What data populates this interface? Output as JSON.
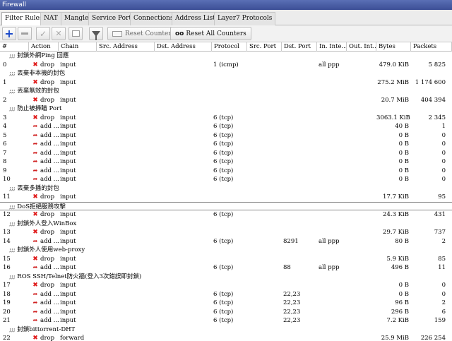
{
  "window": {
    "title": "Firewall"
  },
  "tabs": [
    {
      "label": "Filter Rules",
      "active": true
    },
    {
      "label": "NAT",
      "active": false
    },
    {
      "label": "Mangle",
      "active": false
    },
    {
      "label": "Service Ports",
      "active": false
    },
    {
      "label": "Connections",
      "active": false
    },
    {
      "label": "Address Lists",
      "active": false
    },
    {
      "label": "Layer7 Protocols",
      "active": false
    }
  ],
  "toolbar": {
    "reset_counters": "Reset Counters",
    "reset_all_counters": "Reset All Counters",
    "oo": "oo"
  },
  "columns": [
    "#",
    "Action",
    "Chain",
    "Src. Address",
    "Dst. Address",
    "Protocol",
    "Src. Port",
    "Dst. Port",
    "In. Inte...",
    "Out. Int...",
    "Bytes",
    "Packets"
  ],
  "rows": [
    {
      "type": "comment",
      "text": ";;; 封鎖外網Ping 回應"
    },
    {
      "type": "rule",
      "num": "0",
      "icon": "drop",
      "action": "drop",
      "chain": "input",
      "src": "",
      "dst": "",
      "proto": "1 (icmp)",
      "sport": "",
      "dport": "",
      "inif": "all ppp",
      "outif": "",
      "bytes": "479.0 KiB",
      "packets": "5 825"
    },
    {
      "type": "comment",
      "text": ";;; 丟棄非本機的封包"
    },
    {
      "type": "rule",
      "num": "1",
      "icon": "drop",
      "action": "drop",
      "chain": "input",
      "src": "",
      "dst": "",
      "proto": "",
      "sport": "",
      "dport": "",
      "inif": "",
      "outif": "",
      "bytes": "275.2 MiB",
      "packets": "1 174 600"
    },
    {
      "type": "comment",
      "text": ";;; 丟棄無效的封包"
    },
    {
      "type": "rule",
      "num": "2",
      "icon": "drop",
      "action": "drop",
      "chain": "input",
      "src": "",
      "dst": "",
      "proto": "",
      "sport": "",
      "dport": "",
      "inif": "",
      "outif": "",
      "bytes": "20.7 MiB",
      "packets": "404 394"
    },
    {
      "type": "comment",
      "text": ";;; 防止被掃瞄 Port"
    },
    {
      "type": "rule",
      "num": "3",
      "icon": "drop",
      "action": "drop",
      "chain": "input",
      "src": "",
      "dst": "",
      "proto": "6 (tcp)",
      "sport": "",
      "dport": "",
      "inif": "",
      "outif": "",
      "bytes": "3063.1 KiB",
      "packets": "2 345"
    },
    {
      "type": "rule",
      "num": "4",
      "icon": "add",
      "action": "add ...",
      "chain": "input",
      "src": "",
      "dst": "",
      "proto": "6 (tcp)",
      "sport": "",
      "dport": "",
      "inif": "",
      "outif": "",
      "bytes": "40 B",
      "packets": "1"
    },
    {
      "type": "rule",
      "num": "5",
      "icon": "add",
      "action": "add ...",
      "chain": "input",
      "src": "",
      "dst": "",
      "proto": "6 (tcp)",
      "sport": "",
      "dport": "",
      "inif": "",
      "outif": "",
      "bytes": "0 B",
      "packets": "0"
    },
    {
      "type": "rule",
      "num": "6",
      "icon": "add",
      "action": "add ...",
      "chain": "input",
      "src": "",
      "dst": "",
      "proto": "6 (tcp)",
      "sport": "",
      "dport": "",
      "inif": "",
      "outif": "",
      "bytes": "0 B",
      "packets": "0"
    },
    {
      "type": "rule",
      "num": "7",
      "icon": "add",
      "action": "add ...",
      "chain": "input",
      "src": "",
      "dst": "",
      "proto": "6 (tcp)",
      "sport": "",
      "dport": "",
      "inif": "",
      "outif": "",
      "bytes": "0 B",
      "packets": "0"
    },
    {
      "type": "rule",
      "num": "8",
      "icon": "add",
      "action": "add ...",
      "chain": "input",
      "src": "",
      "dst": "",
      "proto": "6 (tcp)",
      "sport": "",
      "dport": "",
      "inif": "",
      "outif": "",
      "bytes": "0 B",
      "packets": "0"
    },
    {
      "type": "rule",
      "num": "9",
      "icon": "add",
      "action": "add ...",
      "chain": "input",
      "src": "",
      "dst": "",
      "proto": "6 (tcp)",
      "sport": "",
      "dport": "",
      "inif": "",
      "outif": "",
      "bytes": "0 B",
      "packets": "0"
    },
    {
      "type": "rule",
      "num": "10",
      "icon": "add",
      "action": "add ...",
      "chain": "input",
      "src": "",
      "dst": "",
      "proto": "6 (tcp)",
      "sport": "",
      "dport": "",
      "inif": "",
      "outif": "",
      "bytes": "0 B",
      "packets": "0"
    },
    {
      "type": "comment",
      "text": ";;; 丟棄多播的封包"
    },
    {
      "type": "rule",
      "num": "11",
      "icon": "drop",
      "action": "drop",
      "chain": "input",
      "src": "",
      "dst": "",
      "proto": "",
      "sport": "",
      "dport": "",
      "inif": "",
      "outif": "",
      "bytes": "17.7 KiB",
      "packets": "95"
    },
    {
      "type": "comment",
      "text": ";;; DoS拒絕服務攻擊",
      "selected": true
    },
    {
      "type": "rule",
      "num": "12",
      "icon": "drop",
      "action": "drop",
      "chain": "input",
      "src": "",
      "dst": "",
      "proto": "6 (tcp)",
      "sport": "",
      "dport": "",
      "inif": "",
      "outif": "",
      "bytes": "24.3 KiB",
      "packets": "431"
    },
    {
      "type": "comment",
      "text": ";;; 封鎖外人登入WinBox"
    },
    {
      "type": "rule",
      "num": "13",
      "icon": "drop",
      "action": "drop",
      "chain": "input",
      "src": "",
      "dst": "",
      "proto": "",
      "sport": "",
      "dport": "",
      "inif": "",
      "outif": "",
      "bytes": "29.7 KiB",
      "packets": "737"
    },
    {
      "type": "rule",
      "num": "14",
      "icon": "add",
      "action": "add ...",
      "chain": "input",
      "src": "",
      "dst": "",
      "proto": "6 (tcp)",
      "sport": "",
      "dport": "8291",
      "inif": "all ppp",
      "outif": "",
      "bytes": "80 B",
      "packets": "2"
    },
    {
      "type": "comment",
      "text": ";;; 封鎖外人使用web-proxy"
    },
    {
      "type": "rule",
      "num": "15",
      "icon": "drop",
      "action": "drop",
      "chain": "input",
      "src": "",
      "dst": "",
      "proto": "",
      "sport": "",
      "dport": "",
      "inif": "",
      "outif": "",
      "bytes": "5.9 KiB",
      "packets": "85"
    },
    {
      "type": "rule",
      "num": "16",
      "icon": "add",
      "action": "add ...",
      "chain": "input",
      "src": "",
      "dst": "",
      "proto": "6 (tcp)",
      "sport": "",
      "dport": "88",
      "inif": "all ppp",
      "outif": "",
      "bytes": "496 B",
      "packets": "11"
    },
    {
      "type": "comment",
      "text": ";;; ROS SSH/Telnet防火牆(登入3次錯誤即封鎖)"
    },
    {
      "type": "rule",
      "num": "17",
      "icon": "drop",
      "action": "drop",
      "chain": "input",
      "src": "",
      "dst": "",
      "proto": "",
      "sport": "",
      "dport": "",
      "inif": "",
      "outif": "",
      "bytes": "0 B",
      "packets": "0"
    },
    {
      "type": "rule",
      "num": "18",
      "icon": "add",
      "action": "add ...",
      "chain": "input",
      "src": "",
      "dst": "",
      "proto": "6 (tcp)",
      "sport": "",
      "dport": "22,23",
      "inif": "",
      "outif": "",
      "bytes": "0 B",
      "packets": "0"
    },
    {
      "type": "rule",
      "num": "19",
      "icon": "add",
      "action": "add ...",
      "chain": "input",
      "src": "",
      "dst": "",
      "proto": "6 (tcp)",
      "sport": "",
      "dport": "22,23",
      "inif": "",
      "outif": "",
      "bytes": "96 B",
      "packets": "2"
    },
    {
      "type": "rule",
      "num": "20",
      "icon": "add",
      "action": "add ...",
      "chain": "input",
      "src": "",
      "dst": "",
      "proto": "6 (tcp)",
      "sport": "",
      "dport": "22,23",
      "inif": "",
      "outif": "",
      "bytes": "296 B",
      "packets": "6"
    },
    {
      "type": "rule",
      "num": "21",
      "icon": "add",
      "action": "add ...",
      "chain": "input",
      "src": "",
      "dst": "",
      "proto": "6 (tcp)",
      "sport": "",
      "dport": "22,23",
      "inif": "",
      "outif": "",
      "bytes": "7.2 KiB",
      "packets": "159"
    },
    {
      "type": "comment",
      "text": ";;; 封鎖bittorrent-DHT"
    },
    {
      "type": "rule",
      "num": "22",
      "icon": "drop",
      "action": "drop",
      "chain": "forward",
      "src": "",
      "dst": "",
      "proto": "",
      "sport": "",
      "dport": "",
      "inif": "",
      "outif": "",
      "bytes": "25.9 MiB",
      "packets": "226 254"
    }
  ]
}
